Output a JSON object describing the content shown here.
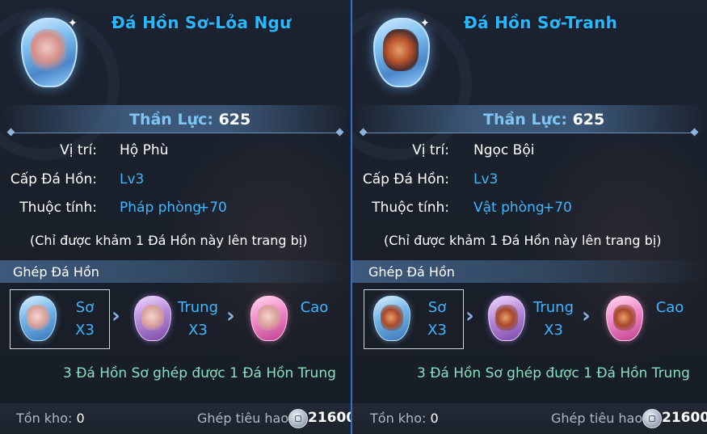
{
  "panels": [
    {
      "title": "Đá Hồn Sơ-Lỏa Ngư",
      "power_label": "Thần Lực:",
      "power_value": "625",
      "position_label": "Vị trí:",
      "position_value": "Hộ Phù",
      "level_label": "Cấp Đá Hồn:",
      "level_value": "Lv3",
      "attribute_label": "Thuộc tính:",
      "attribute_name": "Pháp phòng",
      "attribute_bonus": "+70",
      "note": "(Chỉ được khảm 1 Đá Hồn này lên trang bị)",
      "craft_title": "Ghép Đá Hồn",
      "tiers": [
        {
          "name": "Sơ",
          "qty": "X3"
        },
        {
          "name": "Trung",
          "qty": "X3"
        },
        {
          "name": "Cao",
          "qty": ""
        }
      ],
      "result_text": "3 Đá Hồn Sơ ghép được 1 Đá Hồn Trung",
      "stock_label": "Tồn kho:",
      "stock_value": "0",
      "cost_label": "Ghép tiêu hao:",
      "cost_value": "21600",
      "icons": {
        "gem": "lotus-fish-soul-gem-icon",
        "coin": "silver-coin-icon",
        "arrow": "chevron-right-icon"
      }
    },
    {
      "title": "Đá Hồn Sơ-Tranh",
      "power_label": "Thần Lực:",
      "power_value": "625",
      "position_label": "Vị trí:",
      "position_value": "Ngọc Bội",
      "level_label": "Cấp Đá Hồn:",
      "level_value": "Lv3",
      "attribute_label": "Thuộc tính:",
      "attribute_name": "Vật phòng",
      "attribute_bonus": "+70",
      "note": "(Chỉ được khảm 1 Đá Hồn này lên trang bị)",
      "craft_title": "Ghép Đá Hồn",
      "tiers": [
        {
          "name": "Sơ",
          "qty": "X3"
        },
        {
          "name": "Trung",
          "qty": "X3"
        },
        {
          "name": "Cao",
          "qty": ""
        }
      ],
      "result_text": "3 Đá Hồn Sơ ghép được 1 Đá Hồn Trung",
      "stock_label": "Tồn kho:",
      "stock_value": "0",
      "cost_label": "Ghép tiêu hao:",
      "cost_value": "21600",
      "icons": {
        "gem": "beast-soul-gem-icon",
        "coin": "silver-coin-icon",
        "arrow": "chevron-right-icon"
      }
    }
  ],
  "colors": {
    "title": "#27b8ff",
    "value_blue": "#3fb6ff",
    "result_green": "#86e0bf",
    "panel_divider": "#2f6fd0"
  }
}
